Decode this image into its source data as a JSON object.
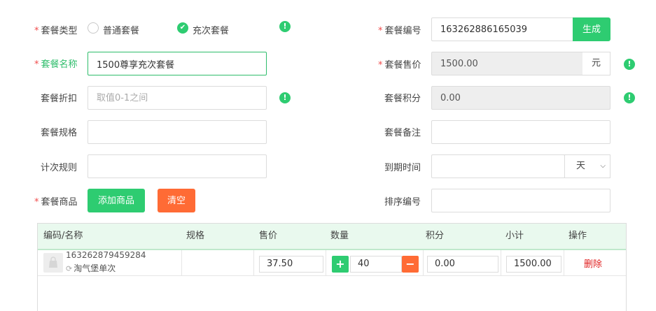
{
  "form": {
    "package_type": {
      "label": "套餐类型",
      "options": [
        "普通套餐",
        "充次套餐"
      ],
      "selected": "充次套餐"
    },
    "package_name": {
      "label": "套餐名称",
      "value": "1500尊享充次套餐"
    },
    "discount": {
      "label": "套餐折扣",
      "placeholder": "取值0-1之间"
    },
    "spec": {
      "label": "套餐规格",
      "value": ""
    },
    "count_rule": {
      "label": "计次规则",
      "value": ""
    },
    "products": {
      "label": "套餐商品",
      "add_label": "添加商品",
      "clear_label": "清空"
    },
    "package_no": {
      "label": "套餐编号",
      "value": "163262886165039",
      "generate_label": "生成"
    },
    "price": {
      "label": "套餐售价",
      "value": "1500.00",
      "unit": "元"
    },
    "points": {
      "label": "套餐积分",
      "value": "0.00"
    },
    "remark": {
      "label": "套餐备注",
      "value": ""
    },
    "expire": {
      "label": "到期时间",
      "value": "",
      "unit_selected": "天"
    },
    "sort_no": {
      "label": "排序编号",
      "value": ""
    },
    "required_mark": "*",
    "info_glyph": "!"
  },
  "table": {
    "headers": [
      "编码/名称",
      "规格",
      "售价",
      "数量",
      "积分",
      "小计",
      "操作"
    ],
    "rows": [
      {
        "code": "163262879459284",
        "name": "淘气堡单次",
        "spec": "",
        "price": "37.50",
        "qty": "40",
        "points": "0.00",
        "subtotal": "1500.00",
        "action": "删除"
      }
    ]
  },
  "colors": {
    "accent": "#2ecc71",
    "danger": "#ff6b35",
    "required": "#f04c4c",
    "delete": "#e02020"
  }
}
